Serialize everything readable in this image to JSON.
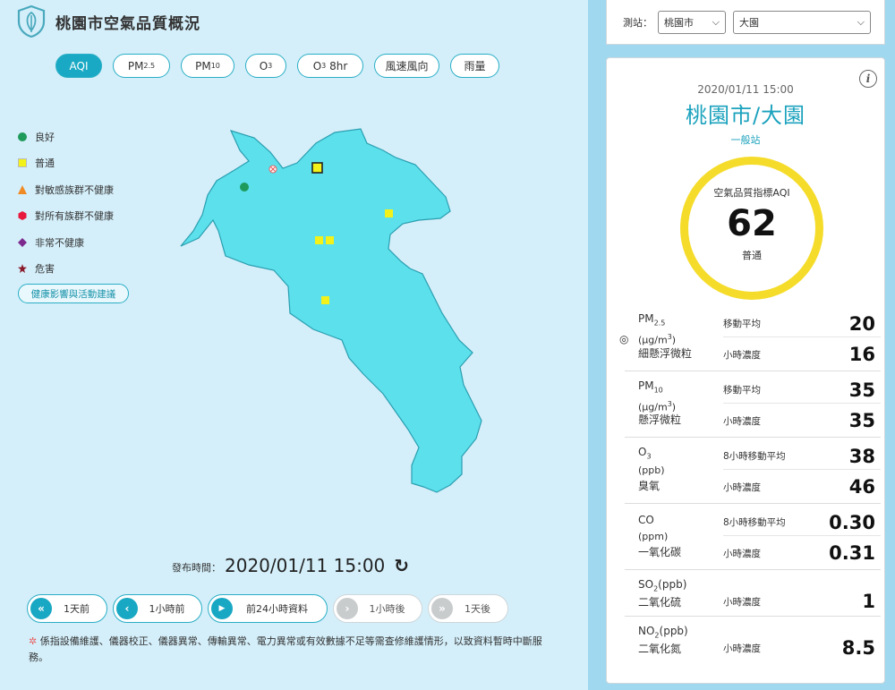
{
  "header": {
    "title": "桃園市空氣品質概況",
    "logo": "leaf-shield-icon"
  },
  "tabs": [
    {
      "label": "AQI",
      "active": true
    },
    {
      "label": "PM",
      "sub": "2.5"
    },
    {
      "label": "PM",
      "sub": "10"
    },
    {
      "label": "O",
      "sub": "3"
    },
    {
      "label": "O",
      "sub": "3",
      "suffix": " 8hr"
    },
    {
      "label": "風速風向"
    },
    {
      "label": "雨量"
    }
  ],
  "legend": {
    "items": [
      {
        "label": "良好",
        "color": "#1e9a5a",
        "shape": "circle"
      },
      {
        "label": "普通",
        "color": "#f2f21a",
        "shape": "square"
      },
      {
        "label": "對敏感族群不健康",
        "color": "#f08a24",
        "shape": "triangle"
      },
      {
        "label": "對所有族群不健康",
        "color": "#e8193c",
        "shape": "hexagon"
      },
      {
        "label": "非常不健康",
        "color": "#7d2a8f",
        "shape": "diamond"
      },
      {
        "label": "危害",
        "color": "#8a1a2a",
        "shape": "star"
      }
    ],
    "health_button": "健康影響與活動建議"
  },
  "publish": {
    "label": "發布時間：",
    "time": "2020/01/11 15:00",
    "refresh_icon": "refresh-icon"
  },
  "nav": [
    {
      "icon": "«",
      "label": "1天前",
      "enabled": true
    },
    {
      "icon": "‹",
      "label": "1小時前",
      "enabled": true
    },
    {
      "icon": "▶",
      "label": "前24小時資料",
      "enabled": true
    },
    {
      "icon": "›",
      "label": "1小時後",
      "enabled": false
    },
    {
      "icon": "»",
      "label": "1天後",
      "enabled": false
    }
  ],
  "notice": "係指設備維護、儀器校正、儀器異常、傳輸異常、電力異常或有效數據不足等需查修維護情形，以致資料暫時中斷服務。",
  "station_select": {
    "label": "測站：",
    "county": "桃園市",
    "station": "大園"
  },
  "panel": {
    "datetime": "2020/01/11 15:00",
    "station_name": "桃園市/大園",
    "station_type": "一般站",
    "aqi_label": "空氣品質指標AQI",
    "aqi_value": "62",
    "aqi_status": "普通",
    "aqi_color": "#f5dc2b"
  },
  "pollutants": [
    {
      "name": "PM",
      "sub": "2.5",
      "unit": "(μg/m",
      "unit_sup": "3",
      "unit_end": ")",
      "desc": "細懸浮微粒",
      "main": true,
      "rows": [
        {
          "metric": "移動平均",
          "value": "20"
        },
        {
          "metric": "小時濃度",
          "value": "16"
        }
      ]
    },
    {
      "name": "PM",
      "sub": "10",
      "unit": "(μg/m",
      "unit_sup": "3",
      "unit_end": ")",
      "desc": "懸浮微粒",
      "rows": [
        {
          "metric": "移動平均",
          "value": "35"
        },
        {
          "metric": "小時濃度",
          "value": "35"
        }
      ]
    },
    {
      "name": "O",
      "sub": "3",
      "unit": "(ppb)",
      "desc": "臭氧",
      "rows": [
        {
          "metric": "8小時移動平均",
          "value": "38"
        },
        {
          "metric": "小時濃度",
          "value": "46"
        }
      ]
    },
    {
      "name": "CO",
      "unit": "(ppm)",
      "desc": "一氧化碳",
      "rows": [
        {
          "metric": "8小時移動平均",
          "value": "0.30"
        },
        {
          "metric": "小時濃度",
          "value": "0.31"
        }
      ]
    },
    {
      "name": "SO",
      "sub": "2",
      "name_suffix": "(ppb)",
      "desc": "二氧化硫",
      "rows": [
        {
          "metric": "小時濃度",
          "value": "1"
        }
      ]
    },
    {
      "name": "NO",
      "sub": "2",
      "name_suffix": "(ppb)",
      "desc": "二氧化氮",
      "rows": [
        {
          "metric": "小時濃度",
          "value": "8.5"
        }
      ]
    }
  ]
}
